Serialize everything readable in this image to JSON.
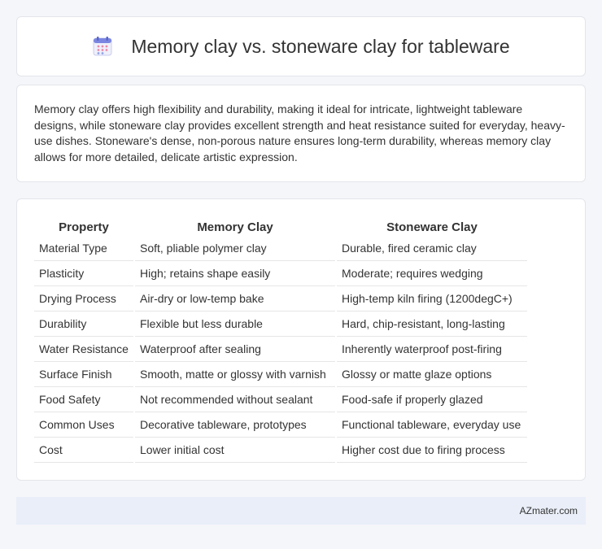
{
  "header": {
    "icon": "calendar-icon",
    "title": "Memory clay vs. stoneware clay for tableware"
  },
  "summary": {
    "text": "Memory clay offers high flexibility and durability, making it ideal for intricate, lightweight tableware designs, while stoneware clay provides excellent strength and heat resistance suited for everyday, heavy-use dishes. Stoneware's dense, non-porous nature ensures long-term durability, whereas memory clay allows for more detailed, delicate artistic expression."
  },
  "table": {
    "headers": [
      "Property",
      "Memory Clay",
      "Stoneware Clay"
    ],
    "rows": [
      [
        "Material Type",
        "Soft, pliable polymer clay",
        "Durable, fired ceramic clay"
      ],
      [
        "Plasticity",
        "High; retains shape easily",
        "Moderate; requires wedging"
      ],
      [
        "Drying Process",
        "Air-dry or low-temp bake",
        "High-temp kiln firing (1200degC+)"
      ],
      [
        "Durability",
        "Flexible but less durable",
        "Hard, chip-resistant, long-lasting"
      ],
      [
        "Water Resistance",
        "Waterproof after sealing",
        "Inherently waterproof post-firing"
      ],
      [
        "Surface Finish",
        "Smooth, matte or glossy with varnish",
        "Glossy or matte glaze options"
      ],
      [
        "Food Safety",
        "Not recommended without sealant",
        "Food-safe if properly glazed"
      ],
      [
        "Common Uses",
        "Decorative tableware, prototypes",
        "Functional tableware, everyday use"
      ],
      [
        "Cost",
        "Lower initial cost",
        "Higher cost due to firing process"
      ]
    ]
  },
  "footer": {
    "text": "AZmater.com"
  }
}
